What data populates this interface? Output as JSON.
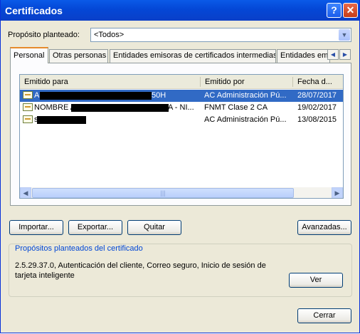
{
  "window": {
    "title": "Certificados"
  },
  "titlebar": {
    "help_label": "?",
    "close_label": "✕"
  },
  "purpose": {
    "label": "Propósito planteado:",
    "value": "<Todos>",
    "dropdown_arrow": "▼"
  },
  "tabs": [
    {
      "label": "Personal",
      "active": true
    },
    {
      "label": "Otras personas"
    },
    {
      "label": "Entidades emisoras de certificados intermedias"
    },
    {
      "label": "Entidades emi"
    }
  ],
  "tab_scroll": {
    "left": "◀",
    "right": "▶"
  },
  "table": {
    "columns": [
      "Emitido para",
      "Emitido por",
      "Fecha d..."
    ],
    "rows": [
      {
        "issued_to_prefix": "A",
        "issued_to_suffix": "50H",
        "issued_by": "AC Administración Pú...",
        "date": "28/07/2017",
        "selected": true
      },
      {
        "issued_to_prefix": "NOMBRE A",
        "issued_to_suffix": "A - NI...",
        "issued_by": "FNMT Clase 2 CA",
        "date": "19/02/2017"
      },
      {
        "issued_to_prefix": "s",
        "issued_to_suffix": "",
        "issued_by": "AC Administración Pú...",
        "date": "13/08/2015"
      }
    ],
    "icon": "certificate-icon"
  },
  "scrollbar": {
    "left": "◀",
    "right": "▶",
    "grip": "|||"
  },
  "buttons": {
    "import": "Importar...",
    "export": "Exportar...",
    "remove": "Quitar",
    "advanced": "Avanzadas...",
    "view": "Ver",
    "close": "Cerrar"
  },
  "purposes_group": {
    "title": "Propósitos planteados del certificado",
    "text": "2.5.29.37.0, Autenticación del cliente, Correo seguro, Inicio de sesión de tarjeta inteligente"
  },
  "colors": {
    "titlebar": "#0a5ae8",
    "selection": "#316ac5",
    "dialog_bg": "#ece9d8",
    "group_title": "#0046d5"
  }
}
